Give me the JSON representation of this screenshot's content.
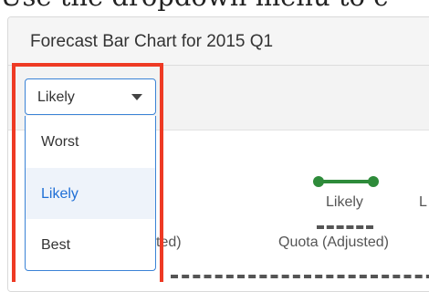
{
  "caption": "Use the dropdown menu to c",
  "panel": {
    "title": "Forecast Bar Chart for 2015 Q1"
  },
  "dropdown": {
    "selected": "Likely",
    "options": [
      {
        "label": "Worst",
        "active": false
      },
      {
        "label": "Likely",
        "active": true
      },
      {
        "label": "Best",
        "active": false
      }
    ]
  },
  "legend": {
    "likely_label": "Likely",
    "next_label_partial": "L",
    "quota_label": "Quota (Adjusted)",
    "left_partial_label": "ted)",
    "colors": {
      "likely": "#2e8b3a",
      "quota": "#555555"
    }
  },
  "annotation": {
    "highlight_color": "#ee3a24"
  }
}
